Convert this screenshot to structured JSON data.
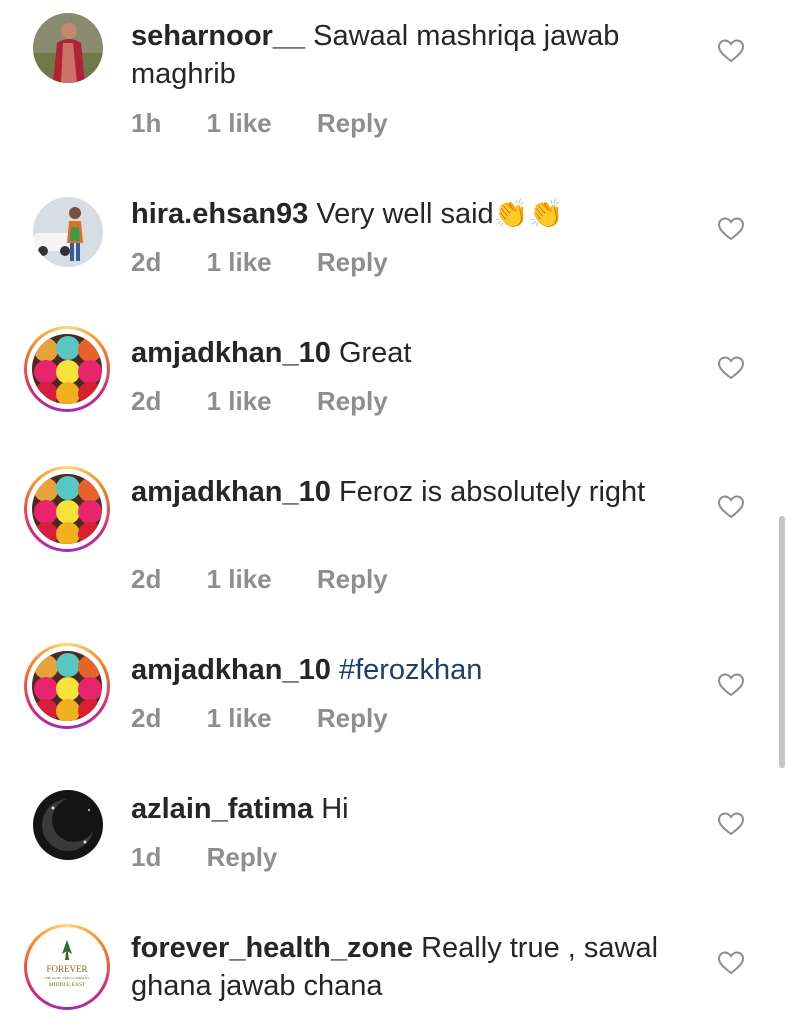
{
  "comments": [
    {
      "username": "seharnoor__",
      "text": "Sawaal mashriqa jawab maghrib",
      "time": "1h",
      "likes": "1 like",
      "reply": "Reply"
    },
    {
      "username": "hira.ehsan93",
      "text": "Very well said",
      "emoji": "👏👏",
      "time": "2d",
      "likes": "1 like",
      "reply": "Reply"
    },
    {
      "username": "amjadkhan_10",
      "text": "Great",
      "time": "2d",
      "likes": "1 like",
      "reply": "Reply"
    },
    {
      "username": "amjadkhan_10",
      "text": "Feroz is absolutely right",
      "time": "2d",
      "likes": "1 like",
      "reply": "Reply"
    },
    {
      "username": "amjadkhan_10",
      "text": "#ferozkhan",
      "time": "2d",
      "likes": "1 like",
      "reply": "Reply"
    },
    {
      "username": "azlain_fatima",
      "text": "Hi",
      "time": "1d",
      "reply": "Reply"
    },
    {
      "username": "forever_health_zone",
      "text": "Really true , sawal ghana jawab chana",
      "avatar_logo": "FOREVER",
      "avatar_logo_sub": "THE ALOE VERA COMPANY",
      "avatar_logo_region": "MIDDLE EAST"
    }
  ],
  "icons": {
    "like": "heart-outline-icon"
  },
  "colors": {
    "text": "#262626",
    "meta": "#8e8e8e",
    "hashtag": "#1b3f6b"
  }
}
